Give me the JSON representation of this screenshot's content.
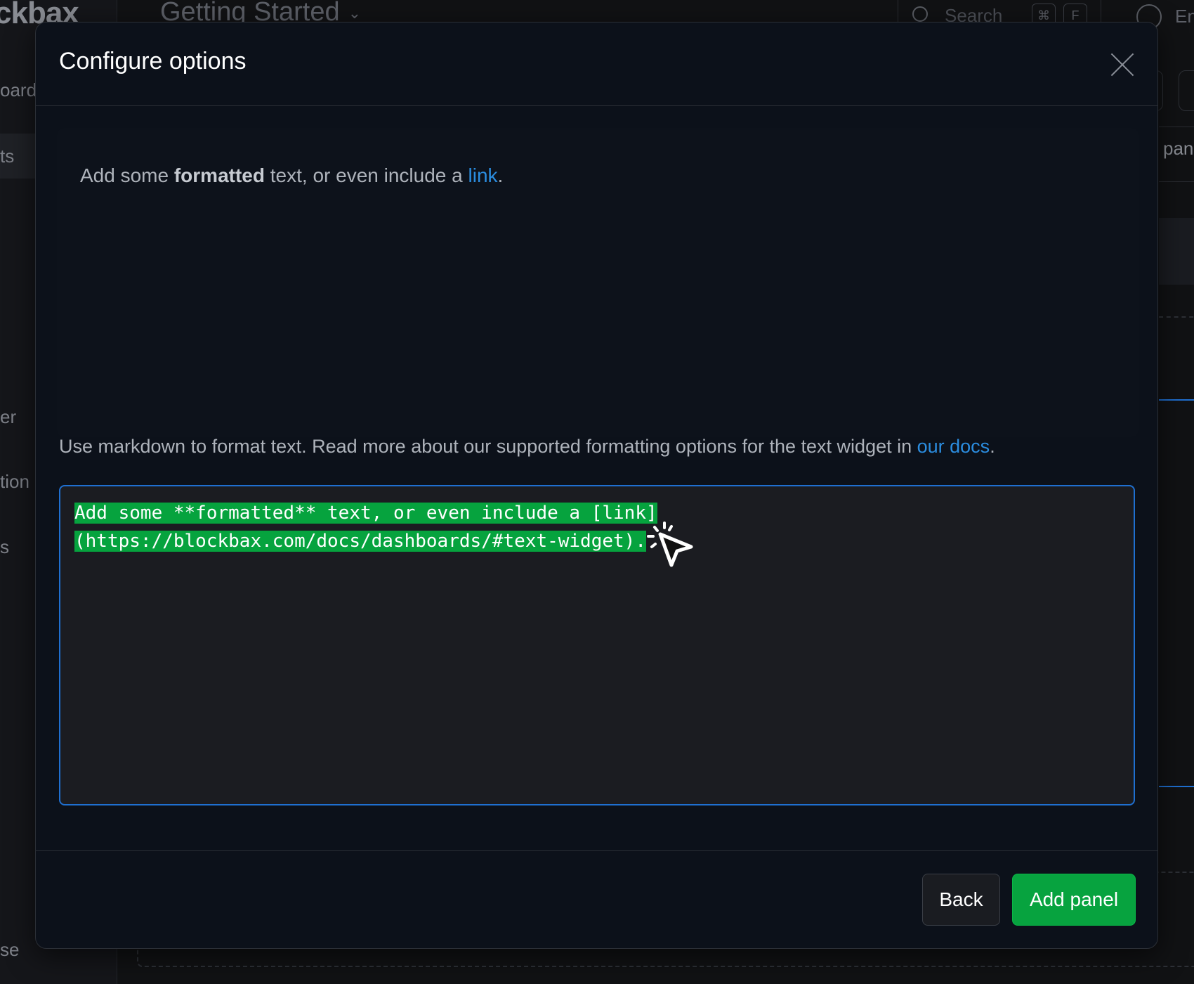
{
  "background": {
    "logo": "ckbax",
    "breadcrumb": "Getting Started",
    "search_placeholder": "Search",
    "shortcut_keys": [
      "⌘",
      "F"
    ],
    "user_label": "En",
    "sidebar_items": [
      "oard",
      "ts",
      "er",
      "tion",
      "s",
      "se"
    ],
    "right_panel_label": "pan"
  },
  "modal": {
    "title": "Configure options",
    "preview": {
      "before": "Add some ",
      "bold": "formatted",
      "middle": " text, or even include a ",
      "link": "link",
      "after": "."
    },
    "help": {
      "text": "Use markdown to format text. Read more about our supported formatting options for the text widget in ",
      "link": "our docs",
      "after": "."
    },
    "editor": {
      "line1": "Add some **formatted** text, or even include a [link]",
      "line2": "(https://blockbax.com/docs/dashboards/#text-widget)."
    },
    "buttons": {
      "back": "Back",
      "add_panel": "Add panel"
    }
  },
  "colors": {
    "accent_green": "#07a33f",
    "link_blue": "#2b8de0",
    "focus_blue": "#1f6fd0"
  }
}
